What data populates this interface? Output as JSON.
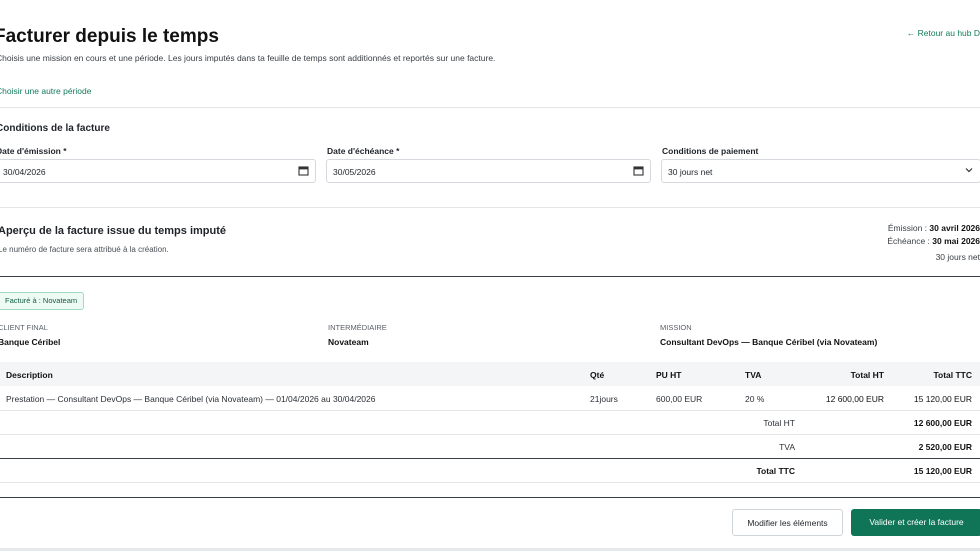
{
  "header": {
    "title": "Facturer depuis le temps",
    "subtitle": "Choisis une mission en cours et une période. Les jours imputés dans ta feuille de temps sont additionnés et reportés sur une facture.",
    "back_link": "← Retour au hub D",
    "other_period": "Choisir une autre période"
  },
  "conditions": {
    "title": "Conditions de la facture",
    "issue_date_label": "Date d'émission *",
    "issue_date_value": "30/04/2026",
    "due_date_label": "Date d'échéance *",
    "due_date_value": "30/05/2026",
    "payment_terms_label": "Conditions de paiement",
    "payment_terms_value": "30 jours net"
  },
  "preview": {
    "title": "Aperçu de la facture issue du temps imputé",
    "note": "Le numéro de facture sera attribué à la création.",
    "emission_label": "Émission : ",
    "emission_value": "30 avril 2026",
    "due_label": "Échéance : ",
    "due_value": "30 mai 2026",
    "terms": "30 jours net",
    "billed_to": "Facturé à : Novateam",
    "client_label": "Client final",
    "client_value": "Banque Céribel",
    "intermediary_label": "Intermédiaire",
    "intermediary_value": "Novateam",
    "mission_label": "Mission",
    "mission_value": "Consultant DevOps — Banque Céribel (via Novateam)"
  },
  "table": {
    "headers": {
      "description": "Description",
      "qty": "Qté",
      "unit_price": "PU HT",
      "vat": "TVA",
      "total_ht": "Total HT",
      "total_ttc": "Total TTC"
    },
    "row": {
      "description": "Prestation — Consultant DevOps — Banque Céribel (via Novateam) — 01/04/2026 au 30/04/2026",
      "qty": "21",
      "qty_unit": "jours",
      "unit_price": "600,00 EUR",
      "vat": "20 %",
      "total_ht": "12 600,00 EUR",
      "total_ttc": "15 120,00 EUR"
    },
    "totals": {
      "total_ht_label": "Total HT",
      "total_ht_value": "12 600,00 EUR",
      "vat_label": "TVA",
      "vat_value": "2 520,00 EUR",
      "total_ttc_label": "Total TTC",
      "total_ttc_value": "15 120,00 EUR"
    }
  },
  "actions": {
    "edit_label": "Modifier les éléments",
    "submit_label": "Valider et créer la facture"
  },
  "icons": {
    "calendar": "calendar-icon",
    "chevron": "chevron-down-icon"
  },
  "colors": {
    "accent": "#107556",
    "link": "#137a5c"
  }
}
